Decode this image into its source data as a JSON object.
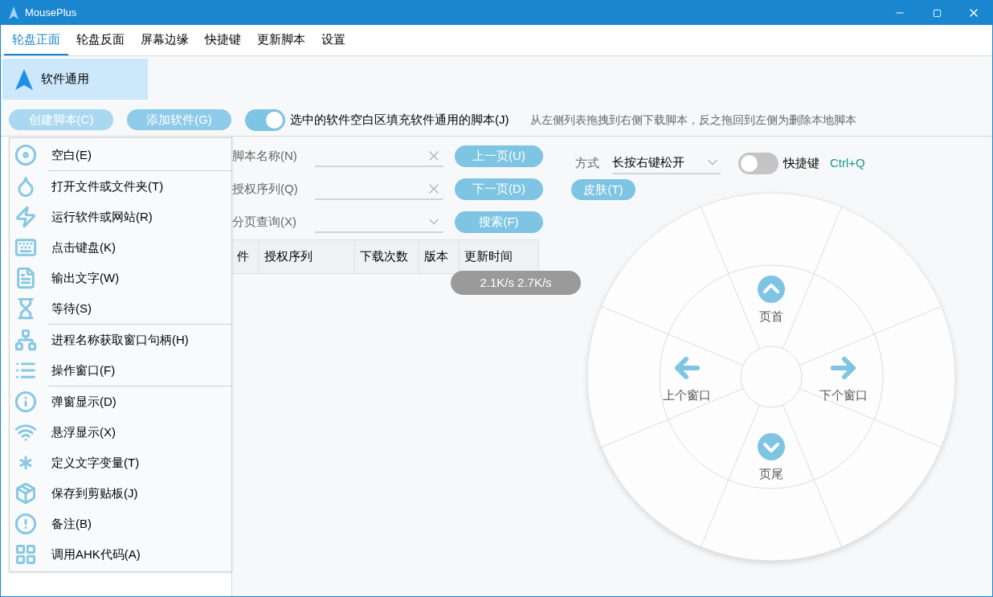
{
  "window": {
    "title": "MousePlus"
  },
  "tabs": [
    {
      "label": "轮盘正面",
      "selected": true
    },
    {
      "label": "轮盘反面",
      "selected": false
    },
    {
      "label": "屏幕边缘",
      "selected": false
    },
    {
      "label": "快捷键",
      "selected": false
    },
    {
      "label": "更新脚本",
      "selected": false
    },
    {
      "label": "设置",
      "selected": false
    }
  ],
  "software_list": [
    {
      "label": "软件通用",
      "selected": true
    }
  ],
  "toolbar": {
    "buttons": [
      {
        "label": "创建脚本(C)",
        "kind": "light"
      },
      {
        "label": "添加软件(G)",
        "kind": "normal"
      }
    ],
    "fill_toggle": {
      "label": "选中的软件空白区填充软件通用的脚本(J)",
      "on": true
    },
    "hint": "从左侧列表拖拽到右侧下载脚本，反之拖回到左侧为删除本地脚本"
  },
  "menu": {
    "groups": [
      [
        "空白(E)"
      ],
      [
        "打开文件或文件夹(T)",
        "运行软件或网站(R)",
        "点击键盘(K)",
        "输出文字(W)",
        "等待(S)"
      ],
      [
        "进程名称获取窗口句柄(H)",
        "操作窗口(F)"
      ],
      [
        "弹窗显示(D)",
        "悬浮显示(X)",
        "定义文字变量(T)",
        "保存到剪贴板(J)",
        "备注(B)",
        "调用AHK代码(A)"
      ]
    ]
  },
  "search": {
    "fields": [
      {
        "label": "脚本名称(N)",
        "kind": "text",
        "button": "上一页(U)"
      },
      {
        "label": "授权序列(Q)",
        "kind": "text",
        "button": "下一页(D)"
      },
      {
        "label": "分页查询(X)",
        "kind": "select",
        "button": "搜索(F)"
      }
    ]
  },
  "table": {
    "columns": [
      "件",
      "授权序列",
      "下载次数",
      "版本",
      "更新时间"
    ]
  },
  "speed_overlay": "2.1K/s 2.7K/s",
  "wheel_settings": {
    "mode_label": "方式",
    "mode_value": "长按右键松开",
    "shortcut_toggle": {
      "label": "快捷键",
      "on": false
    },
    "shortcut": "Ctrl+Q",
    "skin_button": "皮肤(T)"
  },
  "wheel": {
    "segments": [
      {
        "kind": "up",
        "label": "页首"
      },
      {
        "kind": "right",
        "label": "下个窗口"
      },
      {
        "kind": "down",
        "label": "页尾"
      },
      {
        "kind": "left",
        "label": "上个窗口"
      }
    ]
  }
}
